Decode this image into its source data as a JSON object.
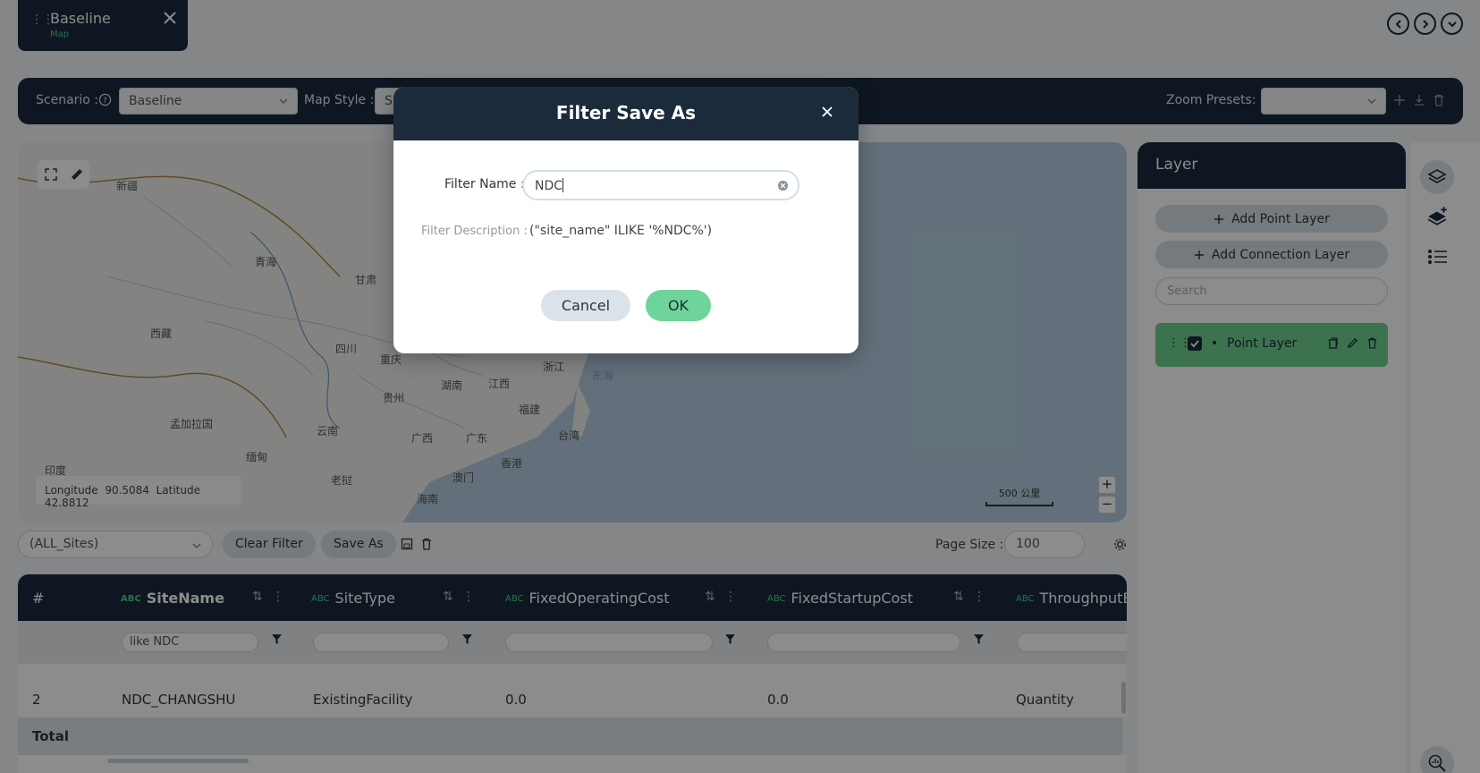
{
  "tab": {
    "title": "Baseline",
    "subtitle": "Map"
  },
  "toolbar": {
    "scenario_label": "Scenario :",
    "scenario_value": "Baseline",
    "map_style_label": "Map Style :",
    "map_style_value": "S",
    "zoom_presets_label": "Zoom Presets: :",
    "zoom_presets_value": ""
  },
  "map": {
    "longitude_label": "Longitude",
    "longitude_value": "90.5084",
    "latitude_label": "Latitude",
    "latitude_value": "42.8812",
    "scale": "500 公里",
    "labels": [
      "新疆",
      "青海",
      "甘肃",
      "西藏",
      "四川",
      "重庆",
      "湖南",
      "江西",
      "浙江",
      "东海",
      "贵州",
      "福建",
      "孟加拉国",
      "云南",
      "广西",
      "广东",
      "台湾",
      "缅甸",
      "香港",
      "澳门",
      "老挝",
      "海南",
      "印度"
    ]
  },
  "filter_bar": {
    "filter_select": "(ALL_Sites)",
    "clear_filter": "Clear Filter",
    "save_as": "Save As",
    "page_size_label": "Page Size :",
    "page_size_value": "100"
  },
  "table": {
    "index_header": "#",
    "type_badge": "ABC",
    "columns": [
      "SiteName",
      "SiteType",
      "FixedOperatingCost",
      "FixedStartupCost",
      "ThroughputBa"
    ],
    "filters": [
      "like NDC",
      "",
      "",
      "",
      ""
    ],
    "row": {
      "index": "2",
      "cells": [
        "NDC_CHANGSHU",
        "ExistingFacility",
        "0.0",
        "0.0",
        "Quantity"
      ]
    },
    "total_label": "Total"
  },
  "layer_panel": {
    "title": "Layer",
    "add_point": "Add Point Layer",
    "add_connection": "Add Connection Layer",
    "search_placeholder": "Search",
    "item_label": "Point Layer"
  },
  "dialog": {
    "title": "Filter Save As",
    "name_label": "Filter Name :",
    "name_value": "NDC",
    "desc_label": "Filter Description :",
    "desc_value": "(\"site_name\" ILIKE '%NDC%')",
    "cancel": "Cancel",
    "ok": "OK"
  },
  "colors": {
    "navy": "#1b2b3c",
    "green": "#6fd49a",
    "accent_green": "#4bd08a"
  }
}
